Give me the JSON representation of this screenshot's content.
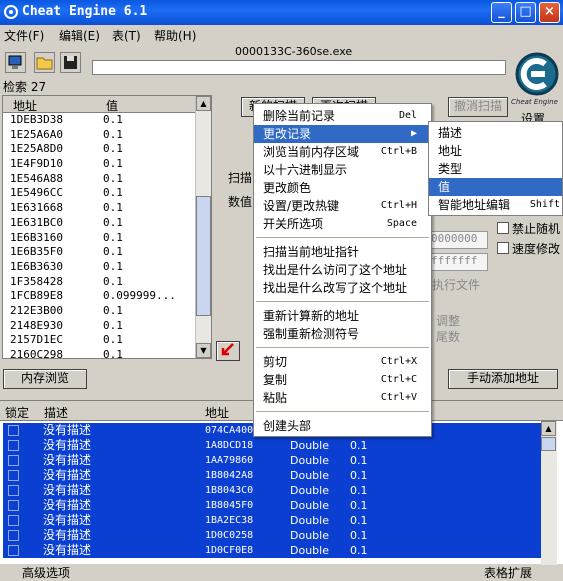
{
  "window": {
    "title": "Cheat Engine 6.1",
    "min": "_",
    "max": "□",
    "close": "×"
  },
  "menu": [
    "文件(F)",
    "编辑(E)",
    "表(T)",
    "帮助(H)"
  ],
  "process": "0000133C-360se.exe",
  "found_count": "检索 27",
  "logo_text": "Cheat Engine",
  "settings_label": "设置",
  "results": {
    "headers": [
      "地址",
      "值"
    ],
    "rows": [
      {
        "a": "1DEB3D38",
        "v": "0.1"
      },
      {
        "a": "1E25A6A0",
        "v": "0.1"
      },
      {
        "a": "1E25A8D0",
        "v": "0.1"
      },
      {
        "a": "1E4F9D10",
        "v": "0.1"
      },
      {
        "a": "1E546A88",
        "v": "0.1"
      },
      {
        "a": "1E5496CC",
        "v": "0.1"
      },
      {
        "a": "1E631668",
        "v": "0.1"
      },
      {
        "a": "1E631BC0",
        "v": "0.1"
      },
      {
        "a": "1E6B3160",
        "v": "0.1"
      },
      {
        "a": "1E6B35F0",
        "v": "0.1"
      },
      {
        "a": "1E6B3630",
        "v": "0.1"
      },
      {
        "a": "1F358428",
        "v": "0.1"
      },
      {
        "a": "1FCB89E8",
        "v": "0.099999..."
      },
      {
        "a": "212E3B00",
        "v": "0.1"
      },
      {
        "a": "2148E930",
        "v": "0.1"
      },
      {
        "a": "2157D1EC",
        "v": "0.1"
      },
      {
        "a": "2160C298",
        "v": "0.1"
      }
    ]
  },
  "buttons": {
    "new_scan": "新的扫描",
    "next_scan": "再次扫描",
    "undo_scan": "撤消扫描",
    "memory_view": "内存浏览",
    "add_manual": "手动添加地址"
  },
  "labels": {
    "scan": "扫描",
    "value": "数值",
    "stop_random": "禁止随机",
    "speedhack": "速度修改",
    "hex1": "0000000",
    "hex2": "fffffff",
    "exec": "执行文件",
    "adjust": "调整",
    "tail": "尾数"
  },
  "context_menu": {
    "items": [
      {
        "label": "删除当前记录",
        "shortcut": "Del"
      },
      {
        "label": "更改记录",
        "shortcut": "▶",
        "selected": true
      },
      {
        "label": "浏览当前内存区域",
        "shortcut": "Ctrl+B"
      },
      {
        "label": "以十六进制显示",
        "shortcut": ""
      },
      {
        "label": "更改颜色",
        "shortcut": ""
      },
      {
        "label": "设置/更改热键",
        "shortcut": "Ctrl+H"
      },
      {
        "label": "开关所选项",
        "shortcut": "Space"
      },
      {
        "label": "扫描当前地址指针",
        "shortcut": ""
      },
      {
        "label": "找出是什么访问了这个地址",
        "shortcut": ""
      },
      {
        "label": "找出是什么改写了这个地址",
        "shortcut": ""
      },
      {
        "label": "重新计算新的地址",
        "shortcut": ""
      },
      {
        "label": "强制重新检测符号",
        "shortcut": ""
      },
      {
        "label": "剪切",
        "shortcut": "Ctrl+X"
      },
      {
        "label": "复制",
        "shortcut": "Ctrl+C"
      },
      {
        "label": "粘贴",
        "shortcut": "Ctrl+V"
      },
      {
        "label": "创建头部",
        "shortcut": ""
      }
    ]
  },
  "submenu": {
    "items": [
      {
        "label": "描述",
        "shortcut": ""
      },
      {
        "label": "地址",
        "shortcut": ""
      },
      {
        "label": "类型",
        "shortcut": ""
      },
      {
        "label": "值",
        "shortcut": "",
        "selected": true
      },
      {
        "label": "智能地址编辑",
        "shortcut": "Shift"
      }
    ]
  },
  "address_table": {
    "headers": [
      "锁定",
      "描述",
      "地址"
    ],
    "rows": [
      {
        "d": "没有描述",
        "a": "074CA400",
        "t": "",
        "v": ""
      },
      {
        "d": "没有描述",
        "a": "1A8DCD18",
        "t": "Double",
        "v": "0.1"
      },
      {
        "d": "没有描述",
        "a": "1AA79860",
        "t": "Double",
        "v": "0.1"
      },
      {
        "d": "没有描述",
        "a": "1B8042A8",
        "t": "Double",
        "v": "0.1"
      },
      {
        "d": "没有描述",
        "a": "1B8043C0",
        "t": "Double",
        "v": "0.1"
      },
      {
        "d": "没有描述",
        "a": "1B8045F0",
        "t": "Double",
        "v": "0.1"
      },
      {
        "d": "没有描述",
        "a": "1BA2EC38",
        "t": "Double",
        "v": "0.1"
      },
      {
        "d": "没有描述",
        "a": "1D0C0258",
        "t": "Double",
        "v": "0.1"
      },
      {
        "d": "没有描述",
        "a": "1D0CF0E8",
        "t": "Double",
        "v": "0.1"
      }
    ]
  },
  "status": {
    "left": "高级选项",
    "right": "表格扩展"
  }
}
